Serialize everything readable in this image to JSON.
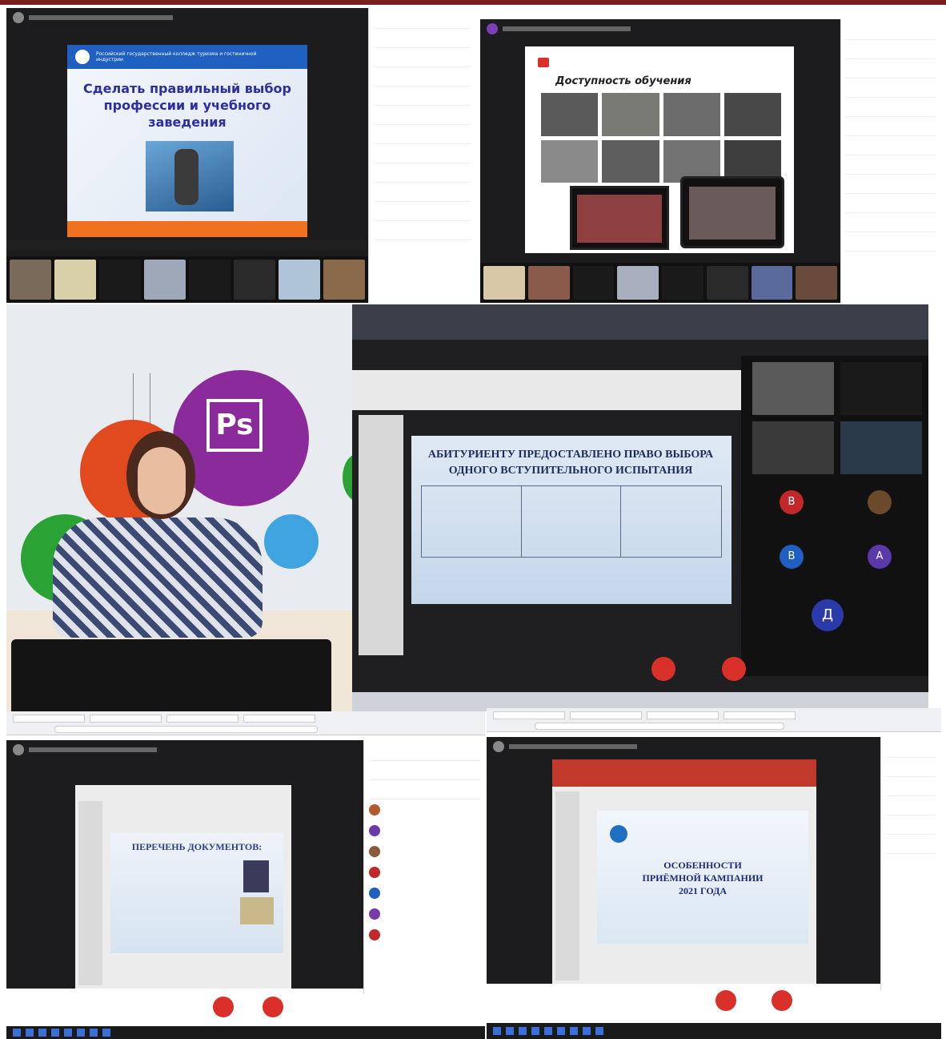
{
  "p1": {
    "header": "Росcийский государственный колледж туризма и гостиничной индустрии",
    "slide_title": "Сделать правильный выбор профессии и учебного заведения"
  },
  "p2": {
    "slide_title": "Доступность обучения"
  },
  "p4": {
    "slide_title": "АБИТУРИЕНТУ ПРЕДОСТАВЛЕНО ПРАВО ВЫБОРА ОДНОГО ВСТУПИТЕЛЬНОГО ИСПЫТАНИЯ",
    "participant_letters": [
      "В",
      "В",
      "А",
      "Д"
    ]
  },
  "p5": {
    "slide_title": "ПЕРЕЧЕНЬ ДОКУМЕНТОВ:"
  },
  "p6": {
    "slide_title": "ОСОБЕННОСТИ ПРИЁМНОЙ КАМПАНИИ 2021 ГОДА"
  },
  "colors": {
    "accent_blue": "#1f4fb8",
    "end_call_red": "#d9302a",
    "dark_bg": "#1c1c1e"
  }
}
